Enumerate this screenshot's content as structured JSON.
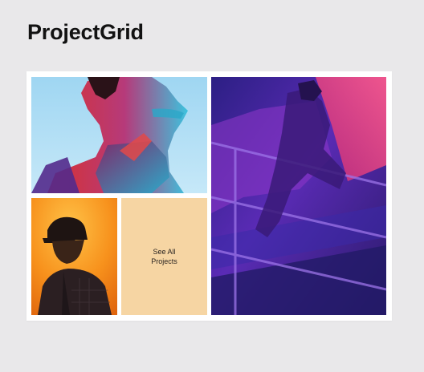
{
  "app": {
    "title": "ProjectGrid"
  },
  "grid": {
    "tiles": [
      {
        "name": "portrait-colorful",
        "colors": [
          "#a9dcf4",
          "#e23d3d",
          "#3cc3de",
          "#532a8c"
        ]
      },
      {
        "name": "staircase-neon",
        "colors": [
          "#2a1f7a",
          "#6c2fc4",
          "#e0326f",
          "#ff6f9a"
        ]
      },
      {
        "name": "portrait-cap-orange",
        "colors": [
          "#ffae2b",
          "#f07b13",
          "#2b1d1a"
        ]
      }
    ],
    "cta": {
      "line1": "See All",
      "line2": "Projects",
      "background": "#f6d5a3"
    }
  }
}
